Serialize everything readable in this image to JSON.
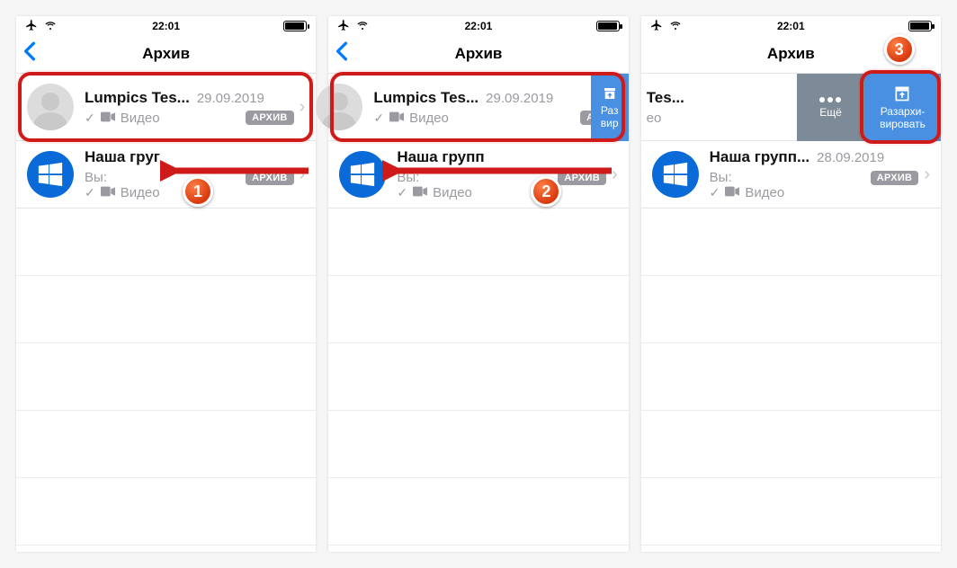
{
  "statusbar": {
    "time": "22:01"
  },
  "navbar": {
    "title": "Архив"
  },
  "chats": {
    "0": {
      "title": "Lumpics Tes...",
      "date": "29.09.2019",
      "preview_label": "Видео",
      "badge": "АРХИВ"
    },
    "1": {
      "title_full": "Наша групп...",
      "title_cut1": "Наша груг",
      "title_cut2": "Наша групп",
      "title_cut3": "Tes...",
      "date": "28.09.2019",
      "sender": "Вы:",
      "preview_label": "Видео",
      "badge": "АРХИВ"
    }
  },
  "swipe": {
    "more": "Ещё",
    "unarchive_line1": "Разархи-",
    "unarchive_line2": "вировать",
    "unarchive_partial_line1": "Раз",
    "unarchive_partial_line2": "вир"
  },
  "steps": {
    "1": "1",
    "2": "2",
    "3": "3"
  }
}
